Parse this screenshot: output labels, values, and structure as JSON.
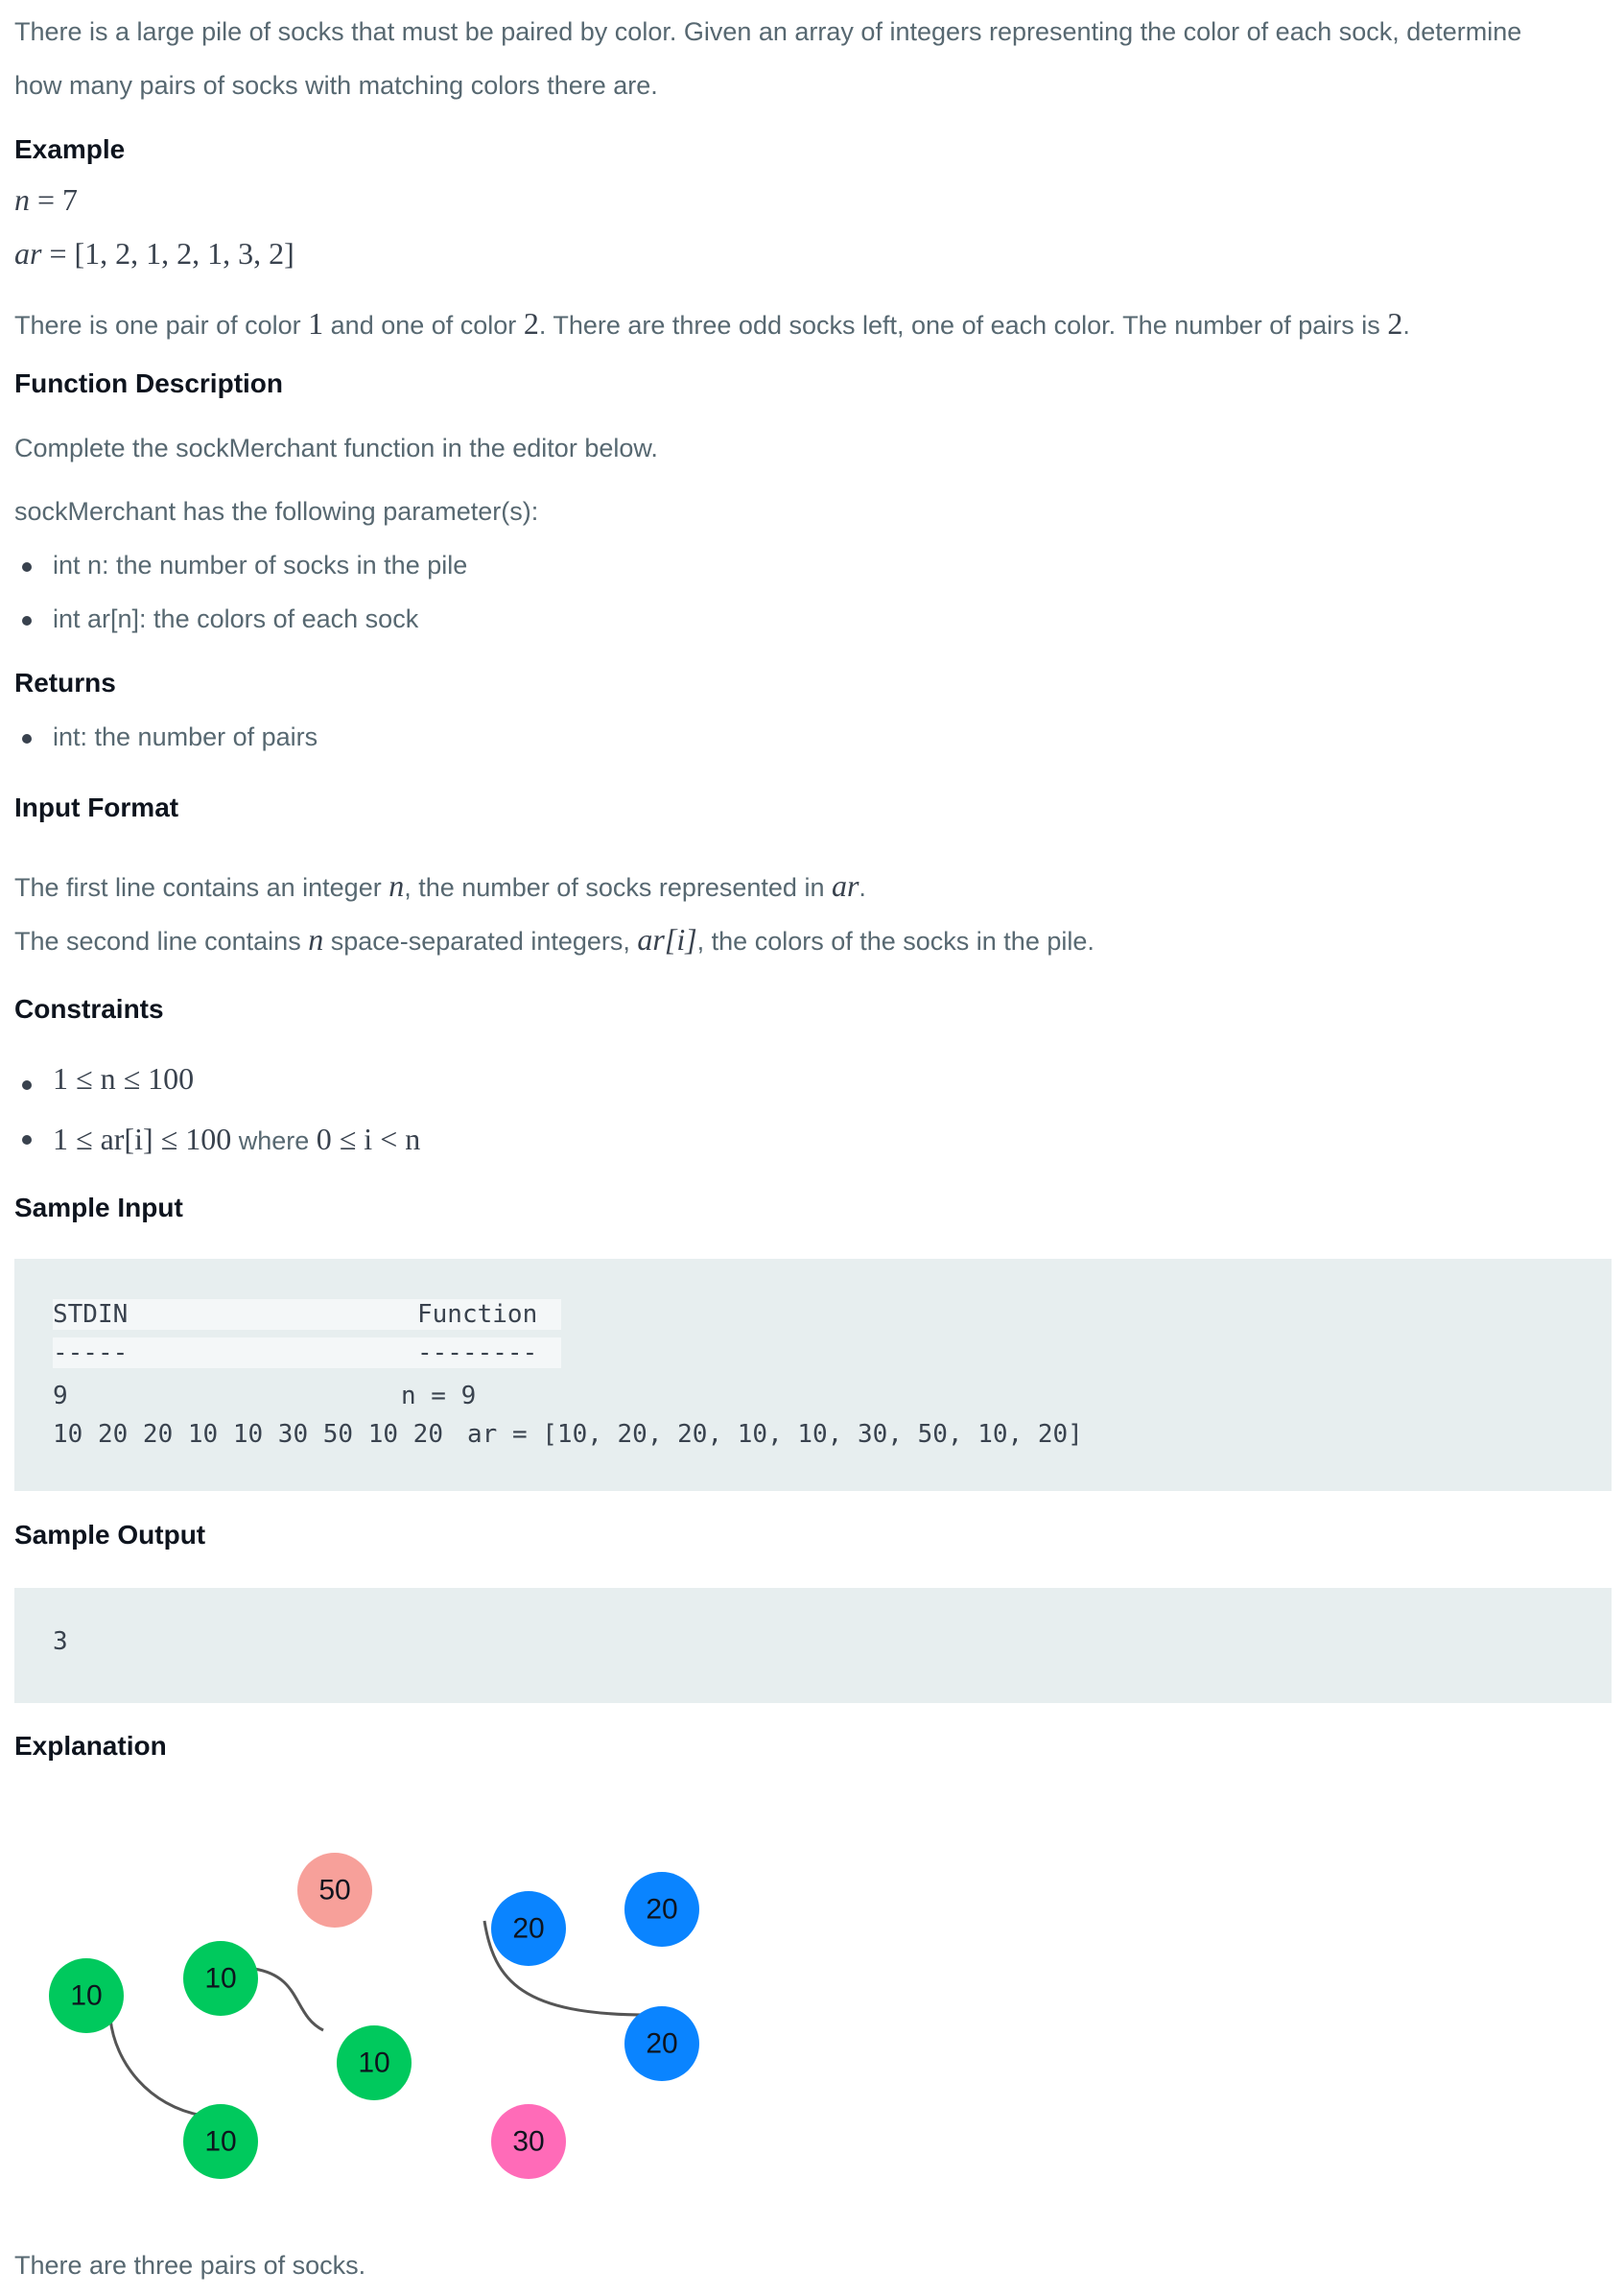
{
  "intro": {
    "line1": "There is a large pile of socks that must be paired by color. Given an array of integers representing the color of each sock, determine",
    "line2": "how many pairs of socks with matching colors there are."
  },
  "example": {
    "heading": "Example",
    "n_var": "n",
    "n_eq": " = 7",
    "ar_var": "ar",
    "ar_eq": " = [1, 2, 1, 2, 1, 3, 2]",
    "explanation": {
      "part1": "There is one pair of color ",
      "m1": "1",
      "part2": " and one of color ",
      "m2": "2",
      "part3": ". There are three odd socks left, one of each color. The number of pairs is ",
      "m3": "2",
      "part4": "."
    }
  },
  "function_description": {
    "heading": "Function Description",
    "complete": "Complete the sockMerchant function in the editor below.",
    "params_intro": "sockMerchant has the following parameter(s):",
    "params": [
      "int n: the number of socks in the pile",
      "int ar[n]: the colors of each sock"
    ]
  },
  "returns": {
    "heading": "Returns",
    "items": [
      "int: the number of pairs"
    ]
  },
  "input_format": {
    "heading": "Input Format",
    "l1a": "The first line contains an integer ",
    "l1m1": "n",
    "l1b": ", the number of socks represented in ",
    "l1m2": "ar",
    "l1c": ".",
    "l2a": "The second line contains ",
    "l2m1": "n",
    "l2b": " space-separated integers, ",
    "l2m2": "ar[i]",
    "l2c": ", the colors of the socks in the pile."
  },
  "constraints": {
    "heading": "Constraints",
    "c1": "1 ≤ n ≤ 100",
    "c2a": "1 ≤ ar[i] ≤ 100",
    "c2b": " where ",
    "c2c": "0 ≤ i < n"
  },
  "sample_input": {
    "heading": "Sample Input",
    "col_stdin": "STDIN",
    "col_function": "Function",
    "dash_stdin": "-----",
    "dash_function": "--------",
    "row1_stdin": "9",
    "row1_function": "n = 9",
    "row2_stdin": "10 20 20 10 10 30 50 10 20",
    "row2_function": "ar = [10, 20, 20, 10, 10, 30, 50, 10, 20]"
  },
  "sample_output": {
    "heading": "Sample Output",
    "value": "3"
  },
  "explanation": {
    "heading": "Explanation",
    "socks": [
      {
        "label": "50",
        "color": "#f7a09a"
      },
      {
        "label": "20",
        "color": "#0a84ff"
      },
      {
        "label": "20",
        "color": "#0a84ff"
      },
      {
        "label": "10",
        "color": "#00c95d"
      },
      {
        "label": "10",
        "color": "#00c95d"
      },
      {
        "label": "20",
        "color": "#0a84ff"
      },
      {
        "label": "10",
        "color": "#00c95d"
      },
      {
        "label": "10",
        "color": "#00c95d"
      },
      {
        "label": "30",
        "color": "#ff6bb8"
      }
    ],
    "footer": "There are three pairs of socks."
  }
}
